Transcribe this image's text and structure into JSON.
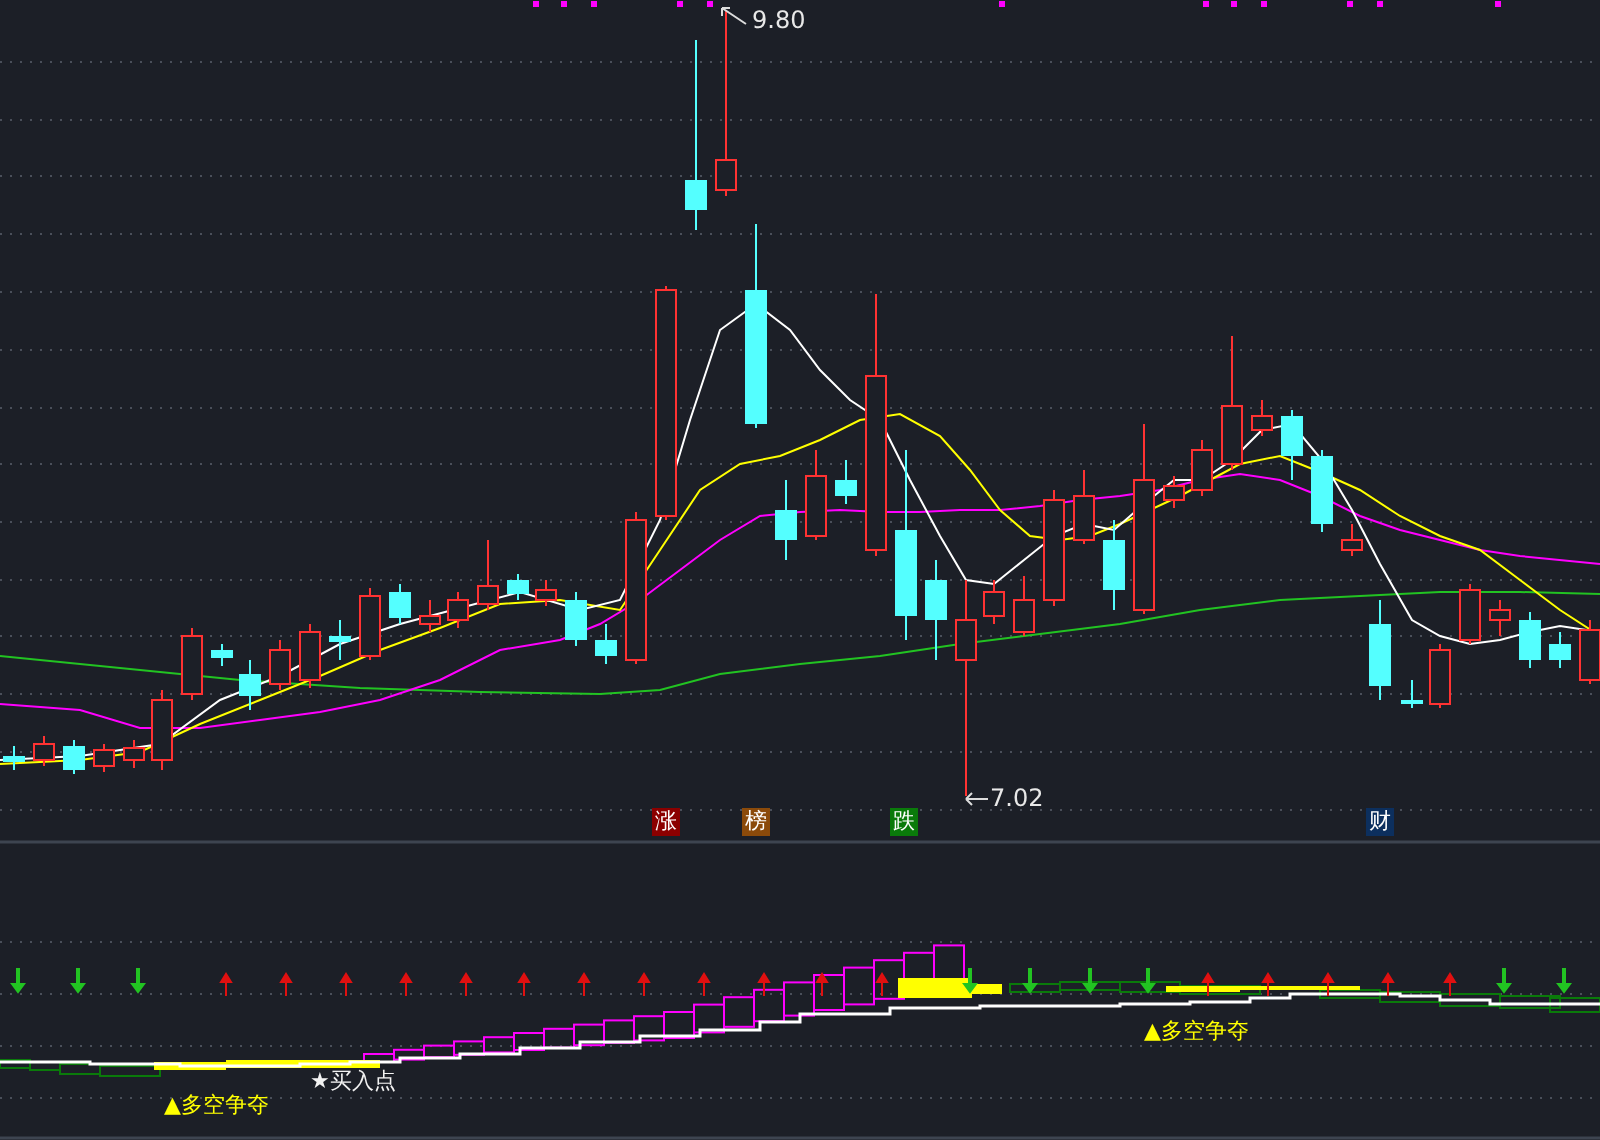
{
  "price_high": {
    "text": "9.80"
  },
  "price_low": {
    "text": "7.02"
  },
  "event_markers": [
    {
      "text": "涨",
      "color": "#8b0000"
    },
    {
      "text": "榜",
      "color": "#8b4a0a"
    },
    {
      "text": "跌",
      "color": "#0a7a0a"
    },
    {
      "text": "财",
      "color": "#0c2f5e"
    }
  ],
  "signals": [
    {
      "kind": "buy",
      "text": "★买入点"
    },
    {
      "kind": "battle",
      "text": "▲多空争夺"
    },
    {
      "kind": "battle",
      "text": "▲多空争夺"
    }
  ]
}
